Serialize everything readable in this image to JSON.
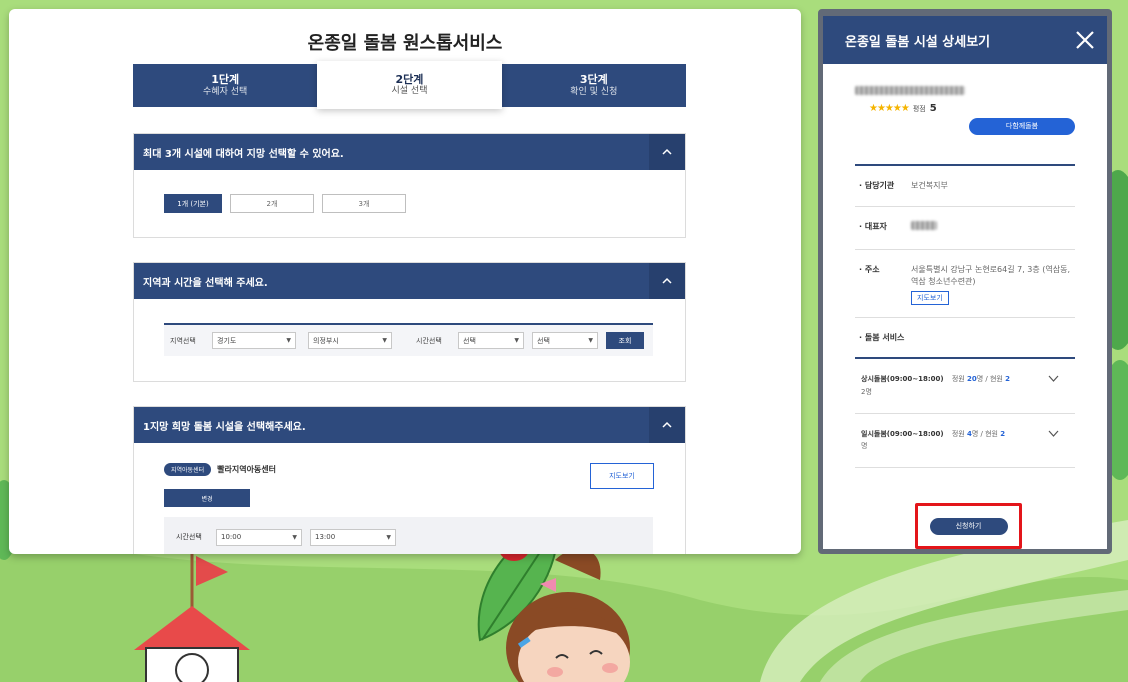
{
  "main": {
    "title": "온종일 돌봄 원스톱서비스",
    "steps": [
      {
        "num": "1단계",
        "label": "수혜자 선택"
      },
      {
        "num": "2단계",
        "label": "시설 선택"
      },
      {
        "num": "3단계",
        "label": "확인 및 신청"
      }
    ],
    "section1": {
      "heading": "최대 3개 시설에 대하여 지망 선택할 수 있어요.",
      "options": [
        "1개 (기본)",
        "2개",
        "3개"
      ]
    },
    "section2": {
      "heading": "지역과 시간을 선택해 주세요.",
      "region_label": "지역선택",
      "region1": "경기도",
      "region2": "의정부시",
      "time_label": "시간선택",
      "time1": "선택",
      "time2": "선택",
      "search_label": "조회"
    },
    "section3": {
      "heading": "1지망 희망 돌봄 시설을 선택해주세요.",
      "badge": "지역아동센터",
      "facility_name": "빨라지역아동센터",
      "map_label": "지도보기",
      "change_label": "변경",
      "time_label": "시간선택",
      "time_from": "10:00",
      "time_to": "13:00"
    }
  },
  "side": {
    "title": "온종일 돌봄 시설 상세보기",
    "stars": "★★★★★",
    "rating_label": "평점",
    "rating_value": "5",
    "type_pill": "다함께돌봄",
    "rows": [
      {
        "key": "담당기관",
        "value": "보건복지부"
      },
      {
        "key": "대표자",
        "value": ""
      },
      {
        "key": "주소",
        "value": "서울특별시 강남구 논현로64길 7, 3층 (역삼동, 역삼 청소년수련관)"
      }
    ],
    "map_label": "지도보기",
    "service_heading": "돌봄 서비스",
    "services": [
      {
        "name": "상시돌봄(09:00~18:00)",
        "cap_label": "정원",
        "cap": "20",
        "cur_label": "명 / 현원",
        "cur": "2",
        "unit": "2명"
      },
      {
        "name": "일시돌봄(09:00~18:00)",
        "cap_label": "정원",
        "cap": "4",
        "cur_label": "명 / 현원",
        "cur": "2",
        "unit": "명"
      }
    ],
    "apply_label": "신청하기"
  }
}
